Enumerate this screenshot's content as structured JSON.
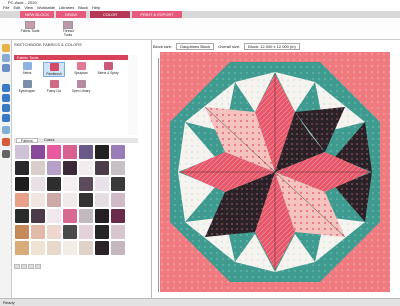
{
  "window": {
    "title": "PC-Ascii... 2020",
    "menu": [
      "File",
      "Edit",
      "View",
      "Worktable",
      "Libraries",
      "Block",
      "Help"
    ]
  },
  "ribbon_tabs": [
    {
      "label": "NEW BLOCK",
      "active": false
    },
    {
      "label": "DRAW",
      "active": false
    },
    {
      "label": "COLOR",
      "active": true
    },
    {
      "label": "PRINT & EXPORT",
      "active": false
    }
  ],
  "ribbon_buttons": [
    {
      "label": "Fabric Tools"
    },
    {
      "label": "Thread Tools"
    }
  ],
  "panel": {
    "header": "SKETCHBOOK FABRICS & COLORS",
    "fabric_tools_title": "Fabric Tools",
    "tools": [
      "Select",
      "Paintbrush",
      "Spraycan",
      "Select & Spray",
      "Eyedropper",
      "Fussy Cut",
      "Open Library"
    ],
    "tabs": [
      "Fabrics",
      "Colors"
    ]
  },
  "block_info": {
    "block_size_label": "Block size:",
    "block_name": "Dauphines Block",
    "overall_label": "Overall size:",
    "overall_value": "Block: 12.000 x 12.000 (in)"
  },
  "status": {
    "text": "Ready"
  },
  "colors": {
    "ribbon_pink": "#e65a7c",
    "accent_red": "#d8405a",
    "teal": "#3f9b90",
    "coral": "#ef7a7f",
    "pink_light": "#f5c2bd",
    "black": "#2a2226",
    "white": "#f7f3ef",
    "mint": "#9fd9d1"
  }
}
